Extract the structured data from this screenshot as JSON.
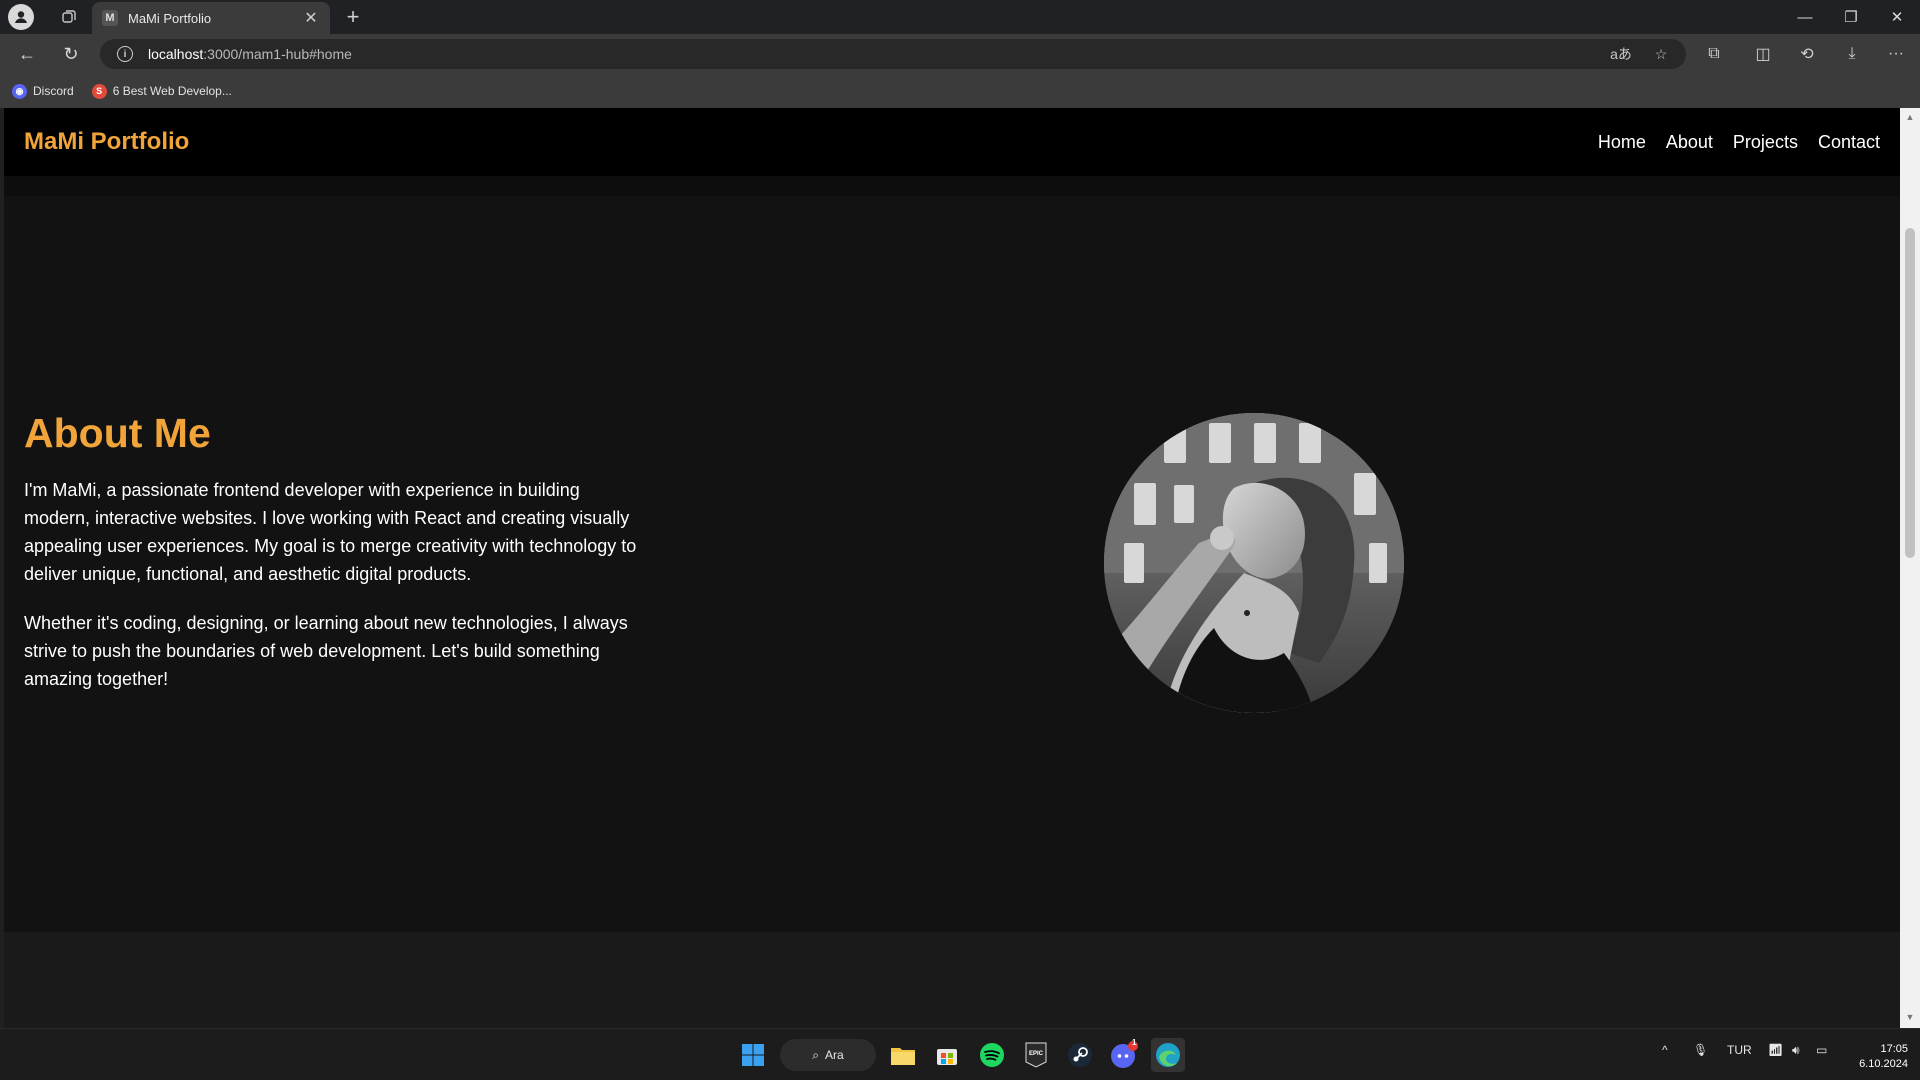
{
  "browser": {
    "tab_title": "MaMi Portfolio",
    "url_host": "localhost",
    "url_rest": ":3000/mam1-hub#home",
    "bookmarks": [
      {
        "label": "Discord",
        "color": "#5865f2",
        "glyph": "D"
      },
      {
        "label": "6 Best Web Develop...",
        "color": "#e04b3b",
        "glyph": "S"
      }
    ]
  },
  "site": {
    "brand": "MaMi Portfolio",
    "nav": [
      "Home",
      "About",
      "Projects",
      "Contact"
    ],
    "about_title": "About Me",
    "about_p1": "I'm MaMi, a passionate frontend developer with experience in building modern, interactive websites. I love working with React and creating visually appealing user experiences. My goal is to merge creativity with technology to deliver unique, functional, and aesthetic digital products.",
    "about_p2": "Whether it's coding, designing, or learning about new technologies, I always strive to push the boundaries of web development. Let's build something amazing together!",
    "accent_color": "#f0a43a",
    "scroll_position": 0.12
  },
  "taskbar": {
    "search_label": "Ara",
    "language": "TUR",
    "time": "17:05",
    "date": "6.10.2024",
    "discord_badge": "1"
  }
}
